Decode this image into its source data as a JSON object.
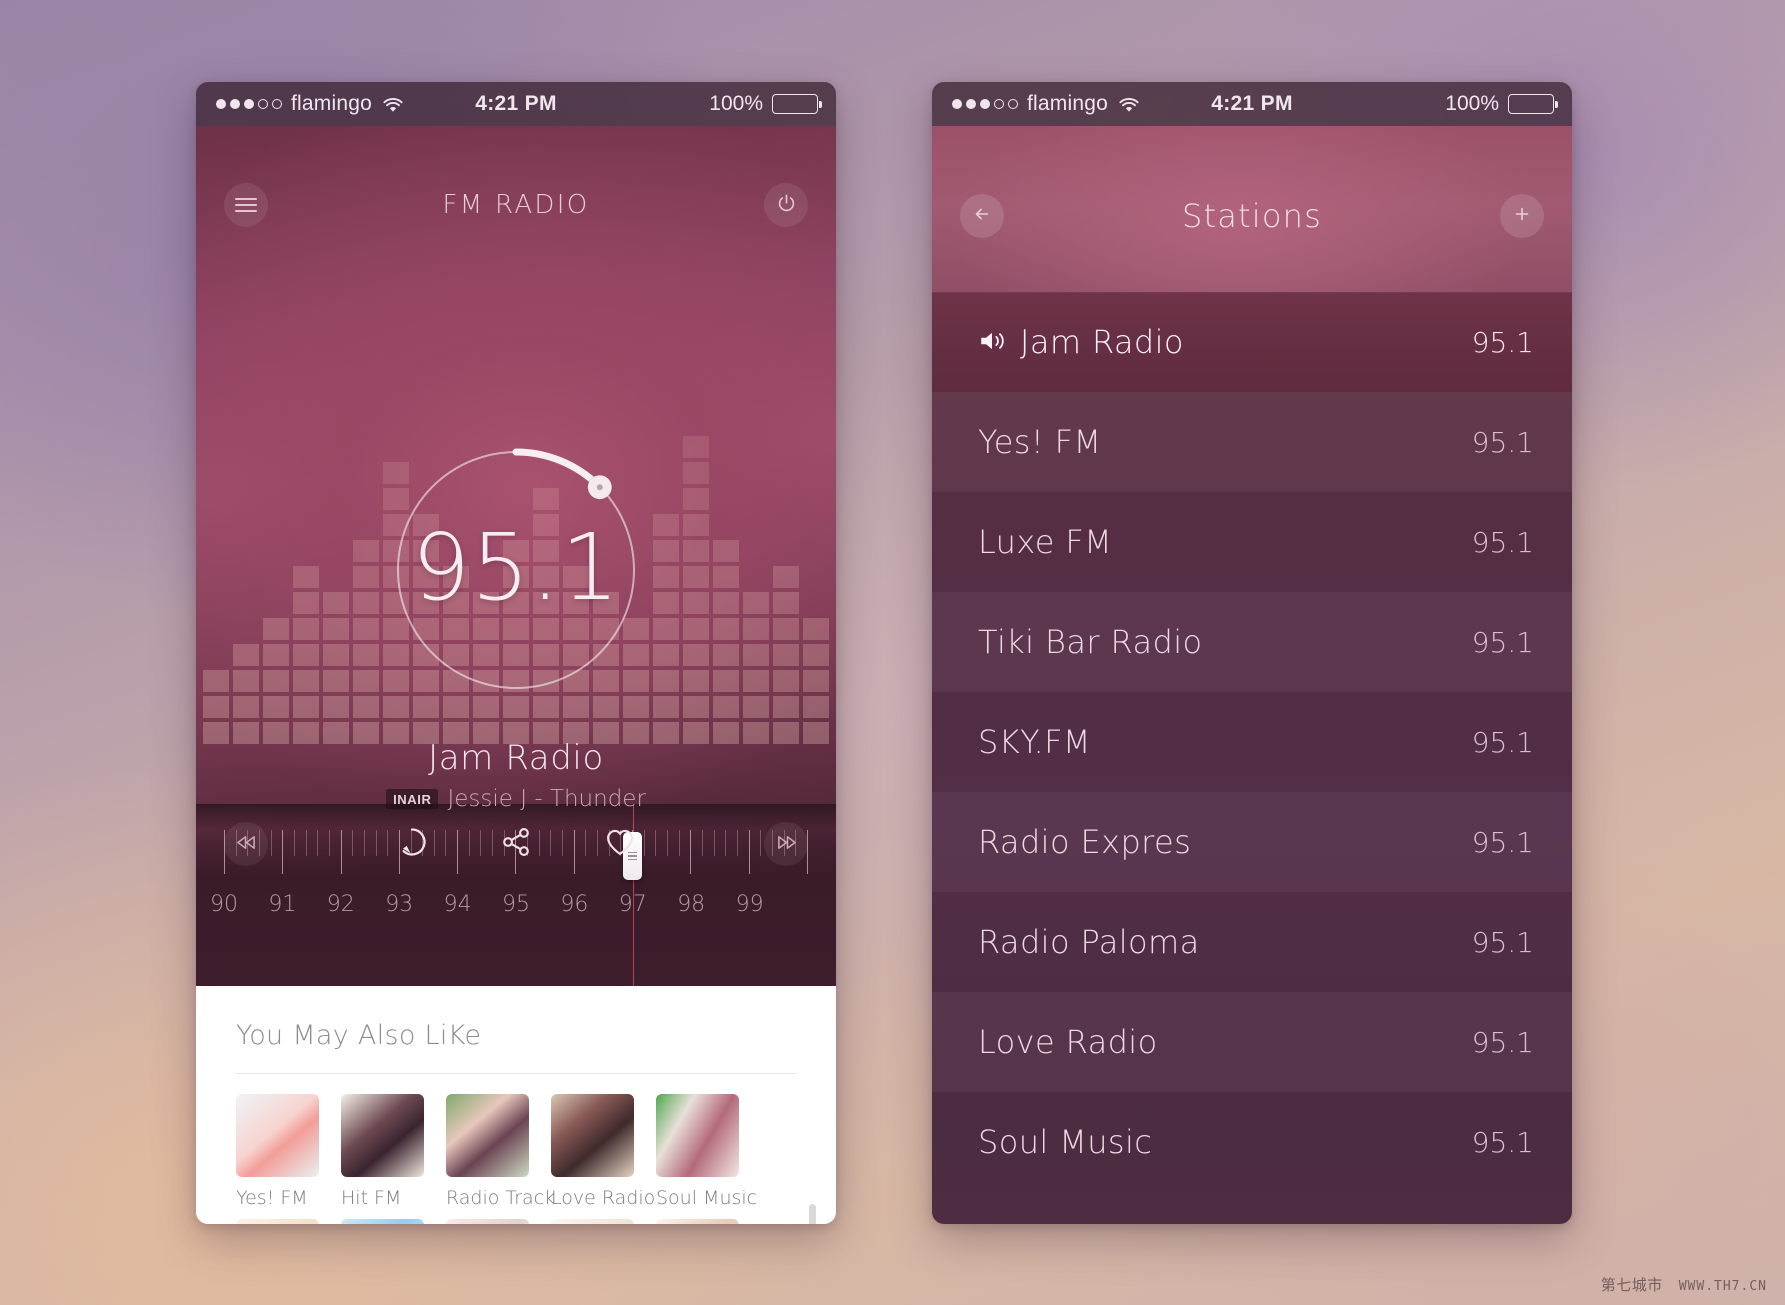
{
  "status_bar": {
    "signal_dots_filled": 3,
    "signal_dots_total": 5,
    "carrier": "flamingo",
    "wifi_icon": "wifi-icon",
    "time": "4:21 PM",
    "battery_percent": "100%",
    "battery_level": 100
  },
  "player": {
    "menu_icon": "hamburger-menu-icon",
    "title": "FM RADIO",
    "power_icon": "power-icon",
    "frequency": "95.1",
    "dial_icon": "dial-knob-icon",
    "station_name": "Jam Radio",
    "badge": "INAIR",
    "track": "Jessie J - Thunder",
    "controls": {
      "prev_icon": "rewind-icon",
      "repeat_icon": "repeat-icon",
      "share_icon": "share-icon",
      "favorite_icon": "heart-icon",
      "next_icon": "fast-forward-icon"
    },
    "tuner": {
      "labels": [
        "90",
        "91",
        "92",
        "93",
        "94",
        "95",
        "96",
        "97",
        "98",
        "99"
      ],
      "handle_position": "97",
      "handle_icon": "tuner-handle-icon"
    }
  },
  "recommendations": {
    "title": "You May Also LiKe",
    "items": [
      {
        "label": "Yes! FM",
        "thumb": "flower-blossom-thumbnail"
      },
      {
        "label": "Hit FM",
        "thumb": "butterfly-thumbnail"
      },
      {
        "label": "Radio Track",
        "thumb": "girl-portrait-thumbnail"
      },
      {
        "label": "Love Radio",
        "thumb": "woman-portrait-thumbnail"
      },
      {
        "label": "Soul Music",
        "thumb": "cupcakes-thumbnail"
      }
    ],
    "second_row_thumbs": [
      "soft-portrait-thumbnail",
      "white-flowers-thumbnail",
      "hands-thumbnail",
      "fabric-thumbnail",
      "portrait-thumbnail"
    ],
    "scrollbar_icon": "vertical-scrollbar"
  },
  "stations": {
    "back_icon": "back-arrow-icon",
    "title": "Stations",
    "add_icon": "plus-icon",
    "playing_icon": "speaker-volume-icon",
    "items": [
      {
        "name": "Jam Radio",
        "frequency": "95.1",
        "active": true
      },
      {
        "name": "Yes! FM",
        "frequency": "95.1",
        "active": false
      },
      {
        "name": "Luxe FM",
        "frequency": "95.1",
        "active": false
      },
      {
        "name": "Tiki Bar Radio",
        "frequency": "95.1",
        "active": false
      },
      {
        "name": "SKY.FM",
        "frequency": "95.1",
        "active": false
      },
      {
        "name": "Radio Expres",
        "frequency": "95.1",
        "active": false
      },
      {
        "name": "Radio Paloma",
        "frequency": "95.1",
        "active": false
      },
      {
        "name": "Love Radio",
        "frequency": "95.1",
        "active": false
      },
      {
        "name": "Soul Music",
        "frequency": "95.1",
        "active": false
      }
    ]
  },
  "watermark": {
    "cn": "第七城市",
    "en": "WWW.TH7.CN"
  },
  "colors": {
    "accent_pink": "#a8526f",
    "deep_plum": "#3b1c2c",
    "panel_white": "#ffffff",
    "needle_red": "#e2506e"
  }
}
